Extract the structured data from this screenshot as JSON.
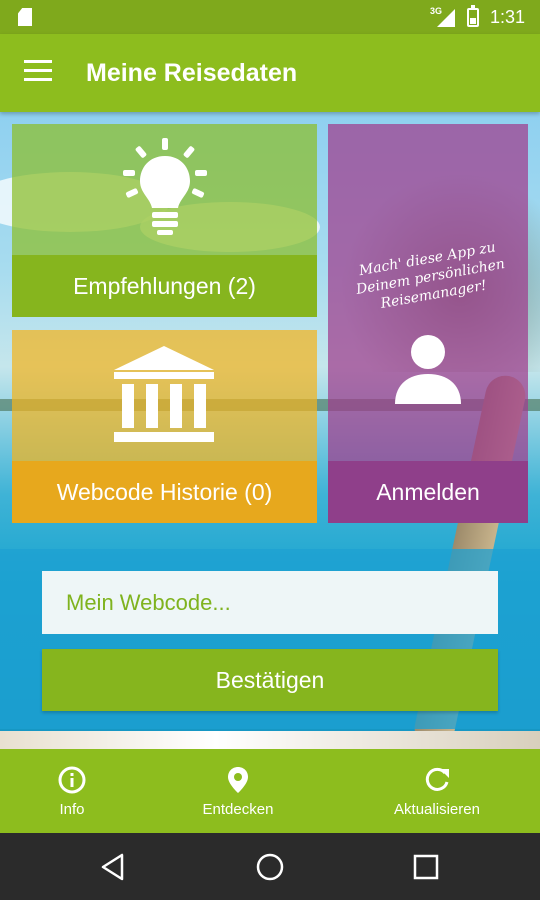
{
  "status_bar": {
    "time": "1:31",
    "network": "3G"
  },
  "app_bar": {
    "title": "Meine Reisedaten"
  },
  "tiles": {
    "empfehlungen": {
      "label": "Empfehlungen (2)"
    },
    "webcode_historie": {
      "label": "Webcode Historie (0)"
    },
    "anmelden": {
      "label": "Anmelden",
      "tagline": "Mach' diese App zu Deinem persönlichen Reisemanager!"
    }
  },
  "form": {
    "webcode_placeholder": "Mein Webcode...",
    "confirm_label": "Bestätigen"
  },
  "bottom_nav": {
    "info": {
      "label": "Info",
      "icon": "info-icon"
    },
    "entdecken": {
      "label": "Entdecken",
      "icon": "location-pin-icon"
    },
    "aktualisieren": {
      "label": "Aktualisieren",
      "icon": "refresh-icon"
    }
  },
  "colors": {
    "primary_green": "#8dbd1e",
    "tile_green": "#86b51e",
    "tile_orange": "#e7a81d",
    "tile_purple": "#8f3f8a",
    "input_text": "#7fb31e"
  }
}
